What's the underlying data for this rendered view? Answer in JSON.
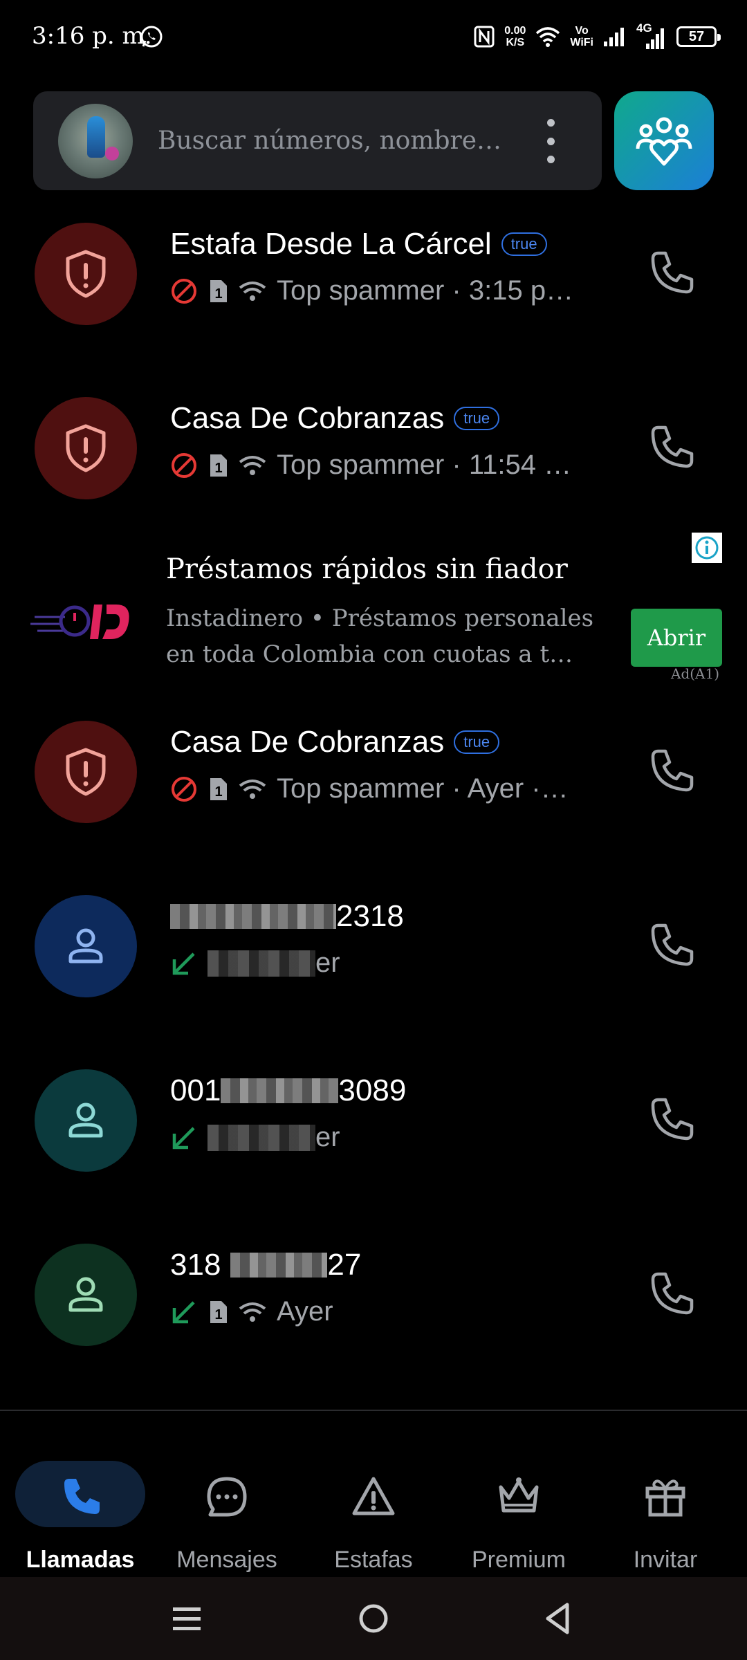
{
  "status_bar": {
    "time": "3:16 p. m.",
    "net_speed_value": "0.00",
    "net_speed_unit": "K/S",
    "vo": "Vo",
    "wifi_label": "WiFi",
    "network": "4G",
    "battery": "57"
  },
  "search": {
    "placeholder": "Buscar números, nombre…"
  },
  "calls": [
    {
      "name": "Estafa Desde La Cárcel",
      "badge": "true",
      "detail": "Top spammer · 3:15 p…",
      "type": "spam"
    },
    {
      "name": "Casa De Cobranzas",
      "badge": "true",
      "detail": "Top spammer · 11:54 …",
      "type": "spam"
    },
    {
      "name": "Casa De Cobranzas",
      "badge": "true",
      "detail": "Top spammer · Ayer ·…",
      "type": "spam"
    },
    {
      "name_suffix": "2318",
      "detail_suffix": "er",
      "type": "incoming"
    },
    {
      "name_prefix": "001",
      "name_suffix": "3089",
      "detail_suffix": "er",
      "type": "incoming"
    },
    {
      "name_prefix": "318",
      "name_suffix": "27",
      "detail": "Ayer",
      "type": "incoming"
    }
  ],
  "ad": {
    "title": "Préstamos rápidos sin fiador",
    "description": "Instadinero • Préstamos personales en toda Colombia con cuotas a t…",
    "button": "Abrir",
    "label": "Ad(A1)"
  },
  "nav": {
    "items": [
      {
        "label": "Llamadas",
        "active": true
      },
      {
        "label": "Mensajes",
        "active": false
      },
      {
        "label": "Estafas",
        "active": false
      },
      {
        "label": "Premium",
        "active": false
      },
      {
        "label": "Invitar",
        "active": false
      }
    ]
  },
  "colors": {
    "spam_circle": "#4f1010",
    "spam_icon": "#f2a39a",
    "blue_circle": "#0d2a5c",
    "teal_circle": "#0b3a3d",
    "green_circle": "#0d3120",
    "incoming_arrow": "#1f9a5a",
    "accent": "#1a73e8"
  }
}
